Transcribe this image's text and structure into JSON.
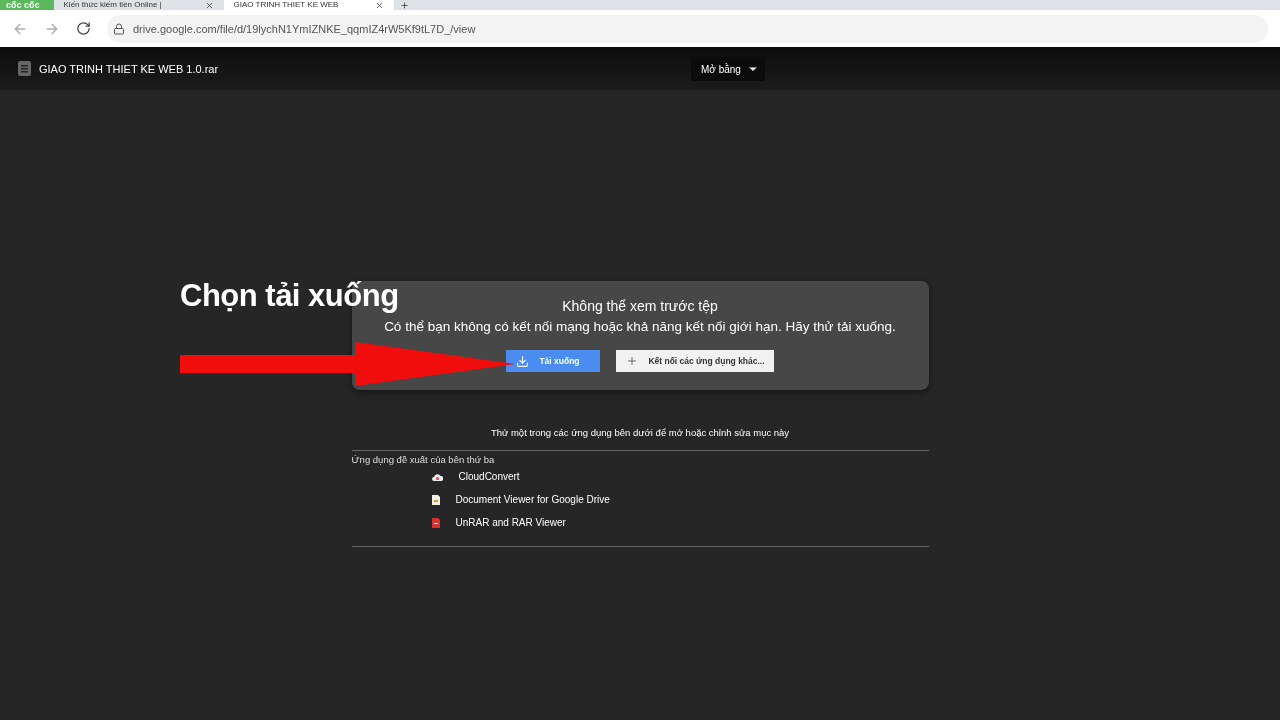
{
  "browser": {
    "brand": "cốc cốc",
    "tabs": [
      {
        "title": "Kiến thức kiếm tiền Online |",
        "selected": false
      },
      {
        "title": "GIAO TRINH THIET KE WEB",
        "selected": true
      }
    ],
    "url": "drive.google.com/file/d/19lychN1YmIZNKE_qqmIZ4rW5Kf9tL7D_/view"
  },
  "viewer": {
    "file_name": "GIAO TRINH THIET KE WEB 1.0.rar",
    "open_with": "Mở bằng"
  },
  "annotation": {
    "label": "Chọn tải xuống"
  },
  "preview_error": {
    "title": "Không thể xem trước tệp",
    "message": "Có thể bạn không có kết nối mạng hoặc khả năng kết nối giới hạn. Hãy thử tải xuống.",
    "buttons": [
      {
        "label": "Tải xuống",
        "kind": "primary"
      },
      {
        "label": "Kết nối các ứng dụng khác...",
        "kind": "secondary"
      }
    ]
  },
  "apps": {
    "hint": "Thử một trong các ứng dụng bên dưới để mở hoặc chỉnh sửa mục này",
    "section": "Ứng dụng đề xuất của bên thứ ba",
    "items": [
      {
        "name": "CloudConvert",
        "kind": "cloud"
      },
      {
        "name": "Document Viewer for Google Drive",
        "kind": "document"
      },
      {
        "name": "UnRAR and RAR Viewer",
        "kind": "archive"
      }
    ]
  }
}
